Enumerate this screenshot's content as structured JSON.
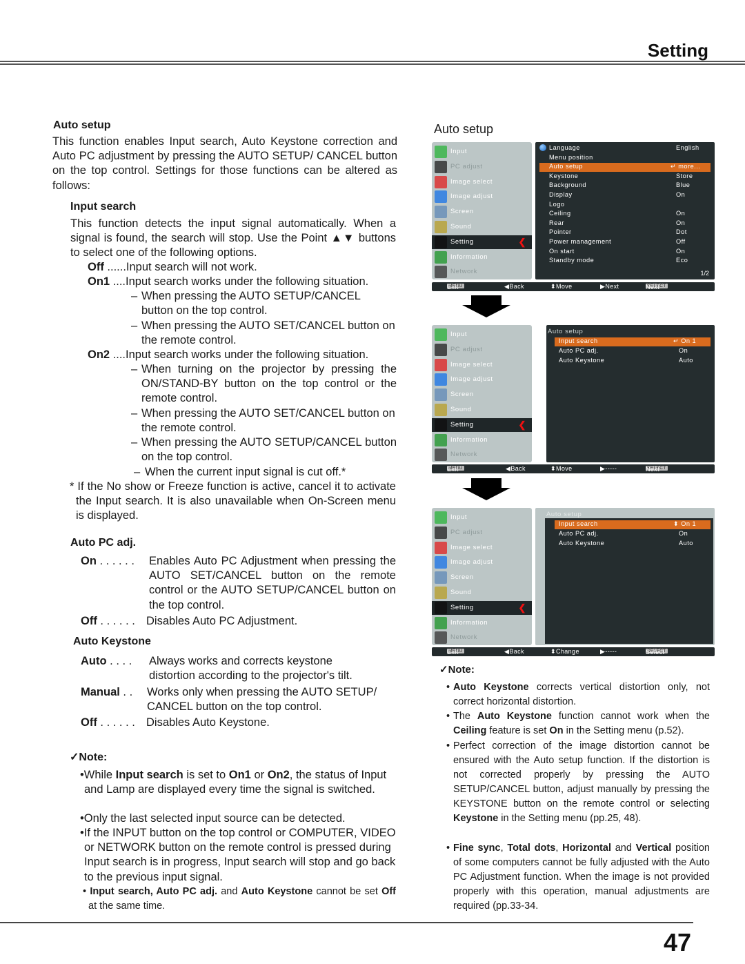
{
  "header": {
    "section_title": "Setting"
  },
  "footer": {
    "page_number": "47"
  },
  "left": {
    "auto_setup_heading": "Auto setup",
    "auto_setup_intro": "This function enables Input search, Auto Keystone correction and Auto PC adjustment by pressing the AUTO SETUP/ CANCEL button on the top control. Settings for those functions can be altered as follows:",
    "input_search": {
      "heading": "Input search",
      "intro": "This function detects the input signal automatically. When a signal is found, the search will stop. Use the Point ▲▼ buttons to select one of the following options.",
      "off_label": "Off",
      "off_dots": " ......",
      "off_text": "Input search will not work.",
      "on1_label": "On1",
      "on1_dots": " ....",
      "on1_text": "Input search works under the following situation.",
      "on1_items": [
        "When pressing the AUTO SETUP/CANCEL button on the top control.",
        "When pressing the AUTO SET/CANCEL button on the remote control."
      ],
      "on2_label": "On2",
      "on2_dots": " ....",
      "on2_text": "Input search works under the following situation.",
      "on2_items": [
        "When turning on the projector by pressing the ON/STAND-BY button on the top control or the remote control.",
        "When pressing the AUTO SET/CANCEL button on the remote control.",
        "When pressing the AUTO SETUP/CANCEL button on the top control.",
        "When the current input signal is cut off.*"
      ],
      "dash": "–",
      "footnote": "* If the No show or Freeze function is active, cancel it to activate the Input search. It is also unavailable when On-Screen menu is displayed."
    },
    "auto_pc_adj": {
      "heading": "Auto PC adj.",
      "on_label": "On",
      "on_dots": " . . . . . .",
      "on_text": "Enables Auto PC Adjustment when pressing the AUTO SET/CANCEL button on the remote control or the AUTO SETUP/CANCEL button on the top control.",
      "off_label": "Off",
      "off_dots": " . . . . . .",
      "off_text": "Disables Auto PC Adjustment."
    },
    "auto_keystone": {
      "heading": "Auto Keystone",
      "auto_label": "Auto",
      "auto_dots": " . . . .",
      "auto_text": "Always works and corrects keystone distortion according to the projector's tilt.",
      "manual_label": "Manual",
      "manual_dots": " . .",
      "manual_text": "Works only when pressing the AUTO SETUP/ CANCEL button on the top control.",
      "off_label": "Off",
      "off_dots": " . . . . . .",
      "off_text": "Disables Auto Keystone."
    },
    "note": {
      "heading": "✓Note:",
      "b1_pre": "•While ",
      "b1_bold1": "Input search",
      "b1_mid1": " is set to ",
      "b1_bold2": "On1",
      "b1_mid2": " or ",
      "b1_bold3": "On2",
      "b1_post": ", the status of Input and Lamp are displayed every time the signal is switched.",
      "b2": "•Only the last selected input source can be detected.",
      "b3": "•If the INPUT button on the top control or COMPUTER, VIDEO or NETWORK button on the remote control is pressed during Input search is in progress, Input search will stop and go back to the previous input signal.",
      "b4_bullet": "• ",
      "b4_bold1": "Input search, Auto PC adj.",
      "b4_mid1": " and ",
      "b4_bold2": "Auto Keystone",
      "b4_mid2": " cannot be set ",
      "b4_bold3": "Off",
      "b4_post": " at the same time."
    }
  },
  "right": {
    "heading": "Auto setup",
    "sidebar_items": [
      {
        "label": "Input",
        "icon": "input-icon",
        "dim": false
      },
      {
        "label": "PC adjust",
        "icon": "pc-adjust-icon",
        "dim": true
      },
      {
        "label": "Image select",
        "icon": "image-select-icon",
        "dim": false
      },
      {
        "label": "Image adjust",
        "icon": "image-adjust-icon",
        "dim": false
      },
      {
        "label": "Screen",
        "icon": "screen-icon",
        "dim": false
      },
      {
        "label": "Sound",
        "icon": "sound-icon",
        "dim": false
      },
      {
        "label": "Setting",
        "icon": "setting-icon",
        "dim": false,
        "selected": true
      },
      {
        "label": "Information",
        "icon": "information-icon",
        "dim": false
      },
      {
        "label": "Network",
        "icon": "network-icon",
        "dim": true
      }
    ],
    "osd1": {
      "items": [
        {
          "label": "Language",
          "value": "English"
        },
        {
          "label": "Menu position",
          "value": ""
        },
        {
          "label": "Auto setup",
          "value": "more...",
          "highlight": true
        },
        {
          "label": "Keystone",
          "value": "Store"
        },
        {
          "label": "Background",
          "value": "Blue"
        },
        {
          "label": "Display",
          "value": "On"
        },
        {
          "label": "Logo",
          "value": ""
        },
        {
          "label": "Ceiling",
          "value": "On"
        },
        {
          "label": "Rear",
          "value": "On"
        },
        {
          "label": "Pointer",
          "value": "Dot"
        },
        {
          "label": "Power management",
          "value": "Off"
        },
        {
          "label": "On start",
          "value": "On"
        },
        {
          "label": "Standby mode",
          "value": "Eco"
        }
      ],
      "page": "1/2",
      "bar": {
        "menu_key": "MENU",
        "exit": "Exit",
        "back": "◀Back",
        "move": "⬍Move",
        "next_arrow": "▶Next",
        "select_key": "SELECT",
        "select_action": "Next"
      }
    },
    "osd2": {
      "title": "Auto setup",
      "items": [
        {
          "label": "Input search",
          "value": "On 1",
          "highlight": true
        },
        {
          "label": "Auto PC adj.",
          "value": "On"
        },
        {
          "label": "Auto Keystone",
          "value": "Auto"
        }
      ],
      "bar": {
        "menu_key": "MENU",
        "exit": "Exit",
        "back": "◀Back",
        "move": "⬍Move",
        "next_arrow": "▶-----",
        "select_key": "SELECT",
        "select_action": "Next"
      }
    },
    "osd3": {
      "title": "Auto setup",
      "items": [
        {
          "label": "Input search",
          "value": "On 1",
          "highlight": true
        },
        {
          "label": "Auto PC adj.",
          "value": "On"
        },
        {
          "label": "Auto Keystone",
          "value": "Auto"
        }
      ],
      "bar": {
        "menu_key": "MENU",
        "exit": "Exit",
        "back": "◀Back",
        "move": "⬍Change",
        "next_arrow": "▶-----",
        "select_key": "SELECT",
        "select_action": "Select"
      }
    },
    "note": {
      "heading": "✓Note:",
      "b1_bold": "Auto Keystone",
      "b1_post": " corrects vertical distortion only, not correct horizontal distortion.",
      "b2_pre": "The ",
      "b2_bold1": "Auto Keystone",
      "b2_mid1": " function cannot work when the ",
      "b2_bold2": "Ceiling",
      "b2_mid2": " feature is set ",
      "b2_bold3": "On",
      "b2_post": " in the Setting menu (p.52).",
      "b3_pre": "Perfect correction of the image distortion cannot be ensured with the Auto setup function. If the distortion is not corrected properly by pressing the AUTO SETUP/CANCEL button, adjust manually by pressing the KEYSTONE button on the remote control or selecting ",
      "b3_bold": "Keystone",
      "b3_post": " in the Setting menu (pp.25, 48).",
      "b4_bold1": "Fine sync",
      "b4_c1": ", ",
      "b4_bold2": "Total dots",
      "b4_c2": ", ",
      "b4_bold3": "Horizontal",
      "b4_and": " and ",
      "b4_bold4": "Vertical",
      "b4_post": " position of some computers cannot be fully adjusted with the Auto PC Adjustment function. When the image is not provided properly with this operation, manual adjustments are required (pp.33-34.",
      "bullet": "•"
    }
  },
  "colors": {
    "osd_highlight": "#d96b1e",
    "osd_dark": "#252d2f",
    "osd_sidebar": "#bcc6c6",
    "osd_arrow_red": "#e11111"
  }
}
